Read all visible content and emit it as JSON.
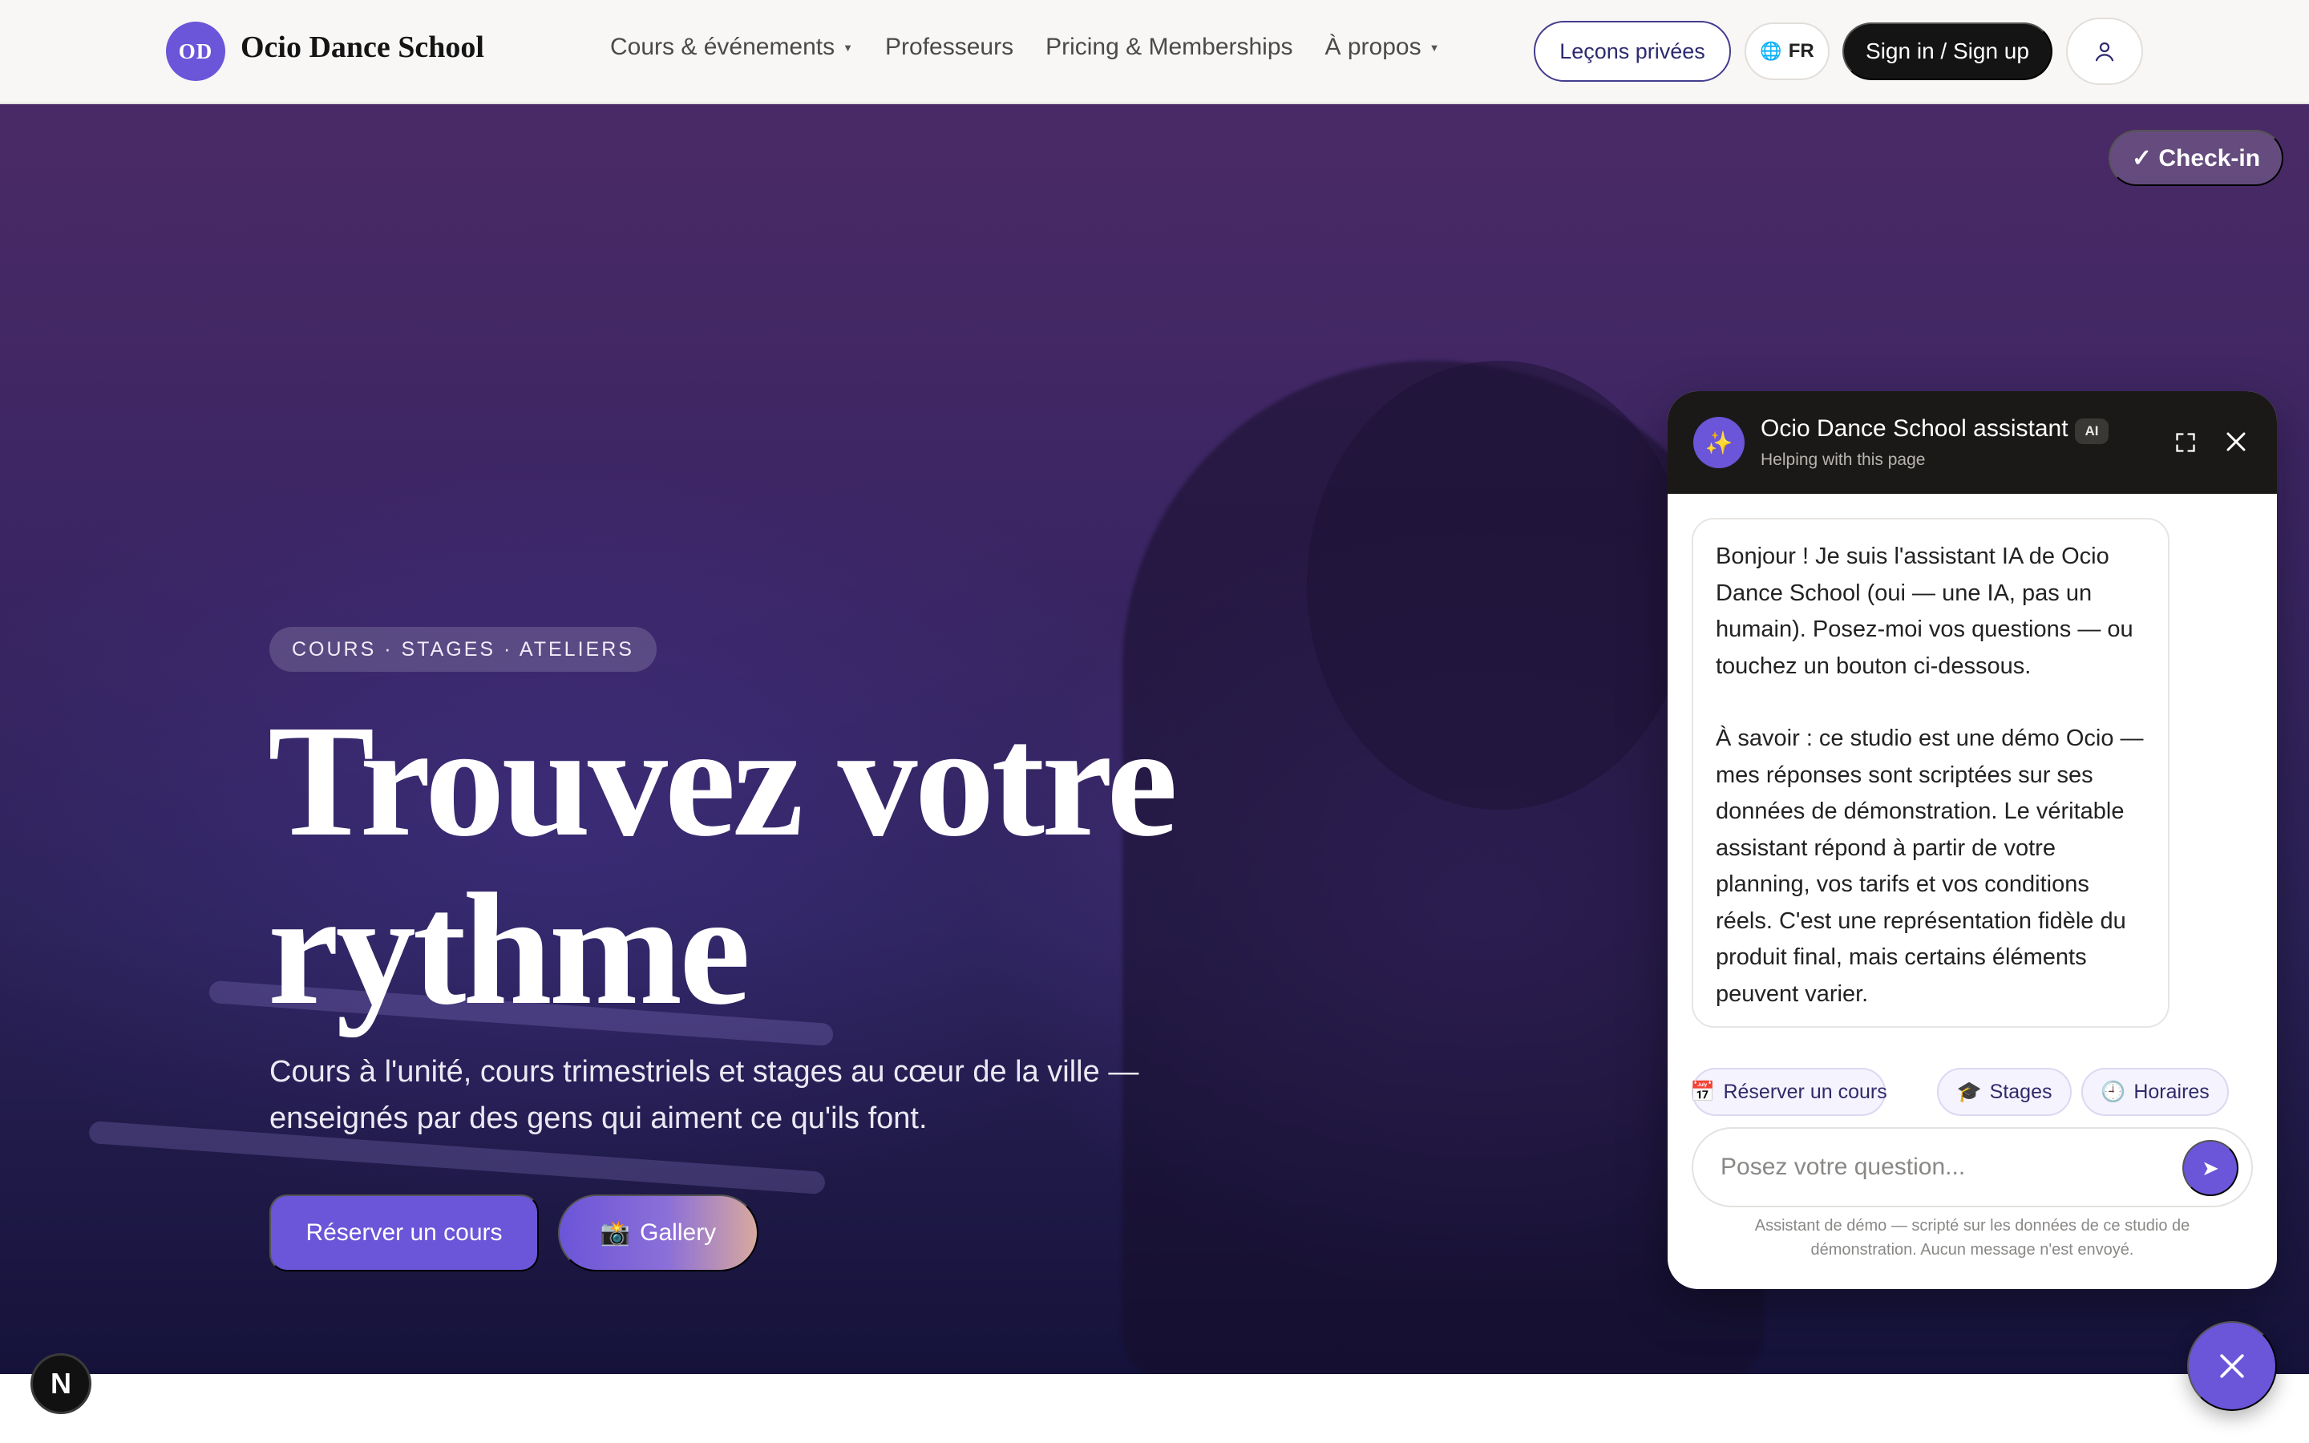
{
  "brand": {
    "initials": "OD",
    "name": "Ocio Dance School"
  },
  "nav": {
    "items": [
      {
        "label": "Cours & événements",
        "has_caret": true
      },
      {
        "label": "Professeurs",
        "has_caret": false
      },
      {
        "label": "Pricing & Memberships",
        "has_caret": false
      },
      {
        "label": "À propos",
        "has_caret": true
      }
    ],
    "private_lessons": "Leçons privées",
    "language": "FR",
    "sign_in": "Sign in / Sign up",
    "icons": {
      "language": "globe-icon",
      "user": "user-icon",
      "caret": "caret-down-icon"
    }
  },
  "hero": {
    "checkin": "✓ Check-in",
    "eyebrow": "COURS · STAGES · ATELIERS",
    "title_line1": "Trouvez votre",
    "title_line2": "rythme",
    "subtitle": "Cours à l'unité, cours trimestriels et stages au cœur de la ville — enseignés par des gens qui aiment ce qu'ils font.",
    "primary_cta": "Réserver un cours",
    "secondary_cta": "Gallery",
    "secondary_cta_icon": "camera-icon"
  },
  "chat": {
    "title": "Ocio Dance School assistant",
    "badge": "AI",
    "subtitle": "Helping with this page",
    "avatar_icon": "sparkles-icon",
    "message_p1": "Bonjour ! Je suis l'assistant IA de Ocio Dance School (oui — une IA, pas un humain). Posez-moi vos questions — ou touchez un bouton ci-dessous.",
    "message_p2": "À savoir : ce studio est une démo Ocio — mes réponses sont scriptées sur ses données de démonstration. Le véritable assistant répond à partir de votre planning, vos tarifs et vos conditions réels. C'est une représentation fidèle du produit final, mais certains éléments peuvent varier.",
    "chips": [
      {
        "icon": "📅",
        "label": "Réserver un cours"
      },
      {
        "icon": "🎓",
        "label": "Stages"
      },
      {
        "icon": "🕘",
        "label": "Horaires"
      }
    ],
    "input_placeholder": "Posez votre question...",
    "input_value": "",
    "disclaimer": "Assistant de démo — scripté sur les données de ce studio de démonstration. Aucun message n'est envoyé."
  },
  "dev_badge": "N",
  "colors": {
    "accent": "#6b55d8",
    "dark": "#141414",
    "nav_bg": "#f8f7f5",
    "hero_top": "#4a2a66",
    "hero_bottom": "#15123a"
  }
}
